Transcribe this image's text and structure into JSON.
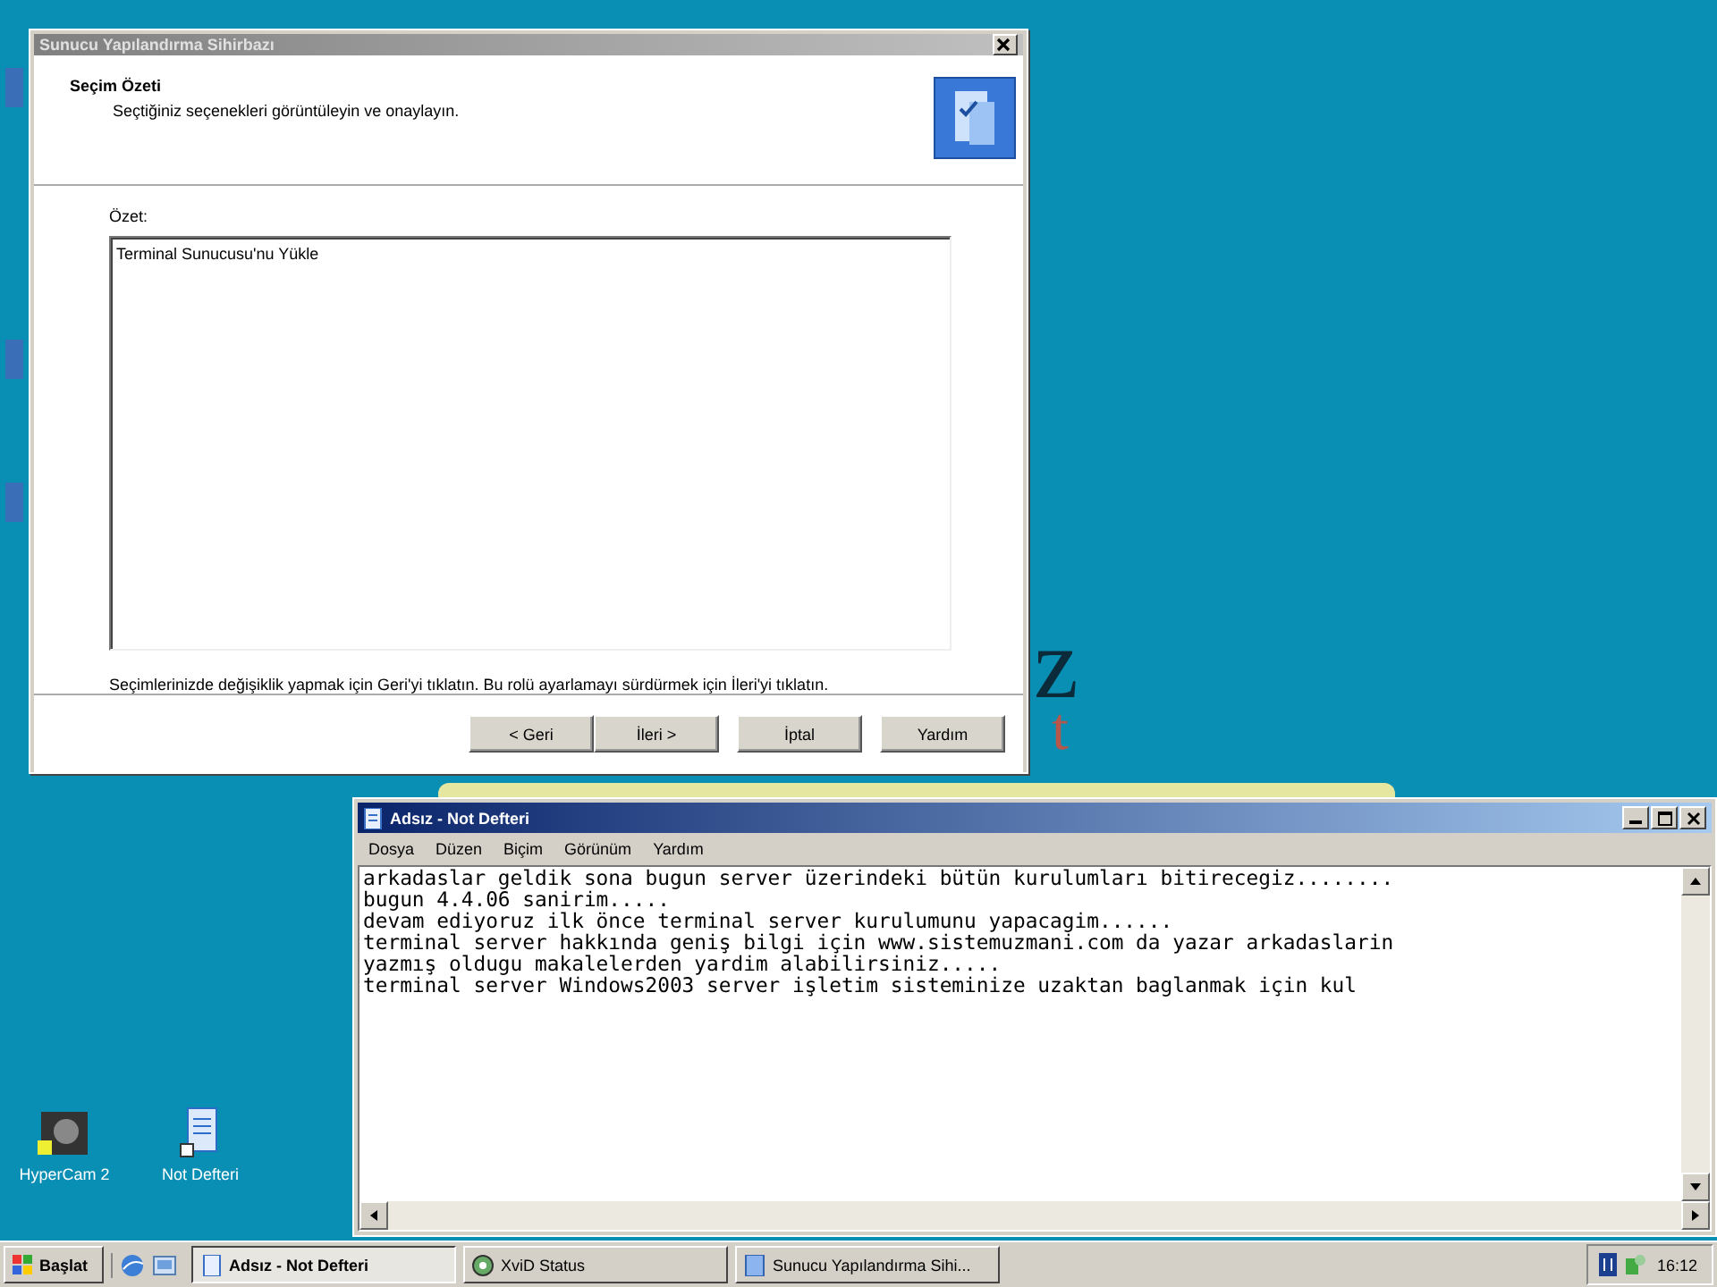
{
  "desktop": {
    "wallpaper_texts": [
      {
        "text": "z",
        "kind": "large"
      },
      {
        "text": "t",
        "kind": "accent"
      }
    ],
    "icons": [
      {
        "label": "HyperCam 2",
        "kind": "camera"
      },
      {
        "label": "Not Defteri",
        "kind": "notepad"
      }
    ]
  },
  "wizard": {
    "title": "Sunucu Yapılandırma Sihirbazı",
    "active": false,
    "heading": "Seçim Özeti",
    "subheading": "Seçtiğiniz seçenekleri görüntüleyin ve onaylayın.",
    "summary_label": "Özet:",
    "summary_text": "Terminal Sunucusu'nu Yükle",
    "hint": "Seçimlerinizde değişiklik yapmak için Geri'yi tıklatın. Bu rolü ayarlamayı sürdürmek için İleri'yi tıklatın.",
    "buttons": [
      "< Geri",
      "İleri >",
      "İptal",
      "Yardım"
    ]
  },
  "notepad": {
    "title": "Adsız - Not Defteri",
    "active": true,
    "menu": [
      "Dosya",
      "Düzen",
      "Biçim",
      "Görünüm",
      "Yardım"
    ],
    "lines": [
      "arkadaslar geldik sona bugun server üzerindeki bütün kurulumları bitirecegiz........",
      "bugun 4.4.06 sanirim.....",
      "devam ediyoruz ilk önce terminal server kurulumunu yapacagim......",
      "terminal server hakkında geniş bilgi için www.sistemuzmani.com da yazar arkadaslarin",
      "yazmış oldugu makalelerden yardim alabilirsiniz.....",
      "terminal server Windows2003 server işletim sisteminize uzaktan baglanmak için kul"
    ]
  },
  "taskbar": {
    "start": "Başlat",
    "tasks": [
      {
        "label": "Adsız - Not Defteri",
        "selected": true,
        "kind": "notepad"
      },
      {
        "label": "XviD Status",
        "selected": false,
        "kind": "xvid"
      },
      {
        "label": "Sunucu Yapılandırma Sihi...",
        "selected": false,
        "kind": "wizard"
      }
    ],
    "clock": "16:12"
  }
}
